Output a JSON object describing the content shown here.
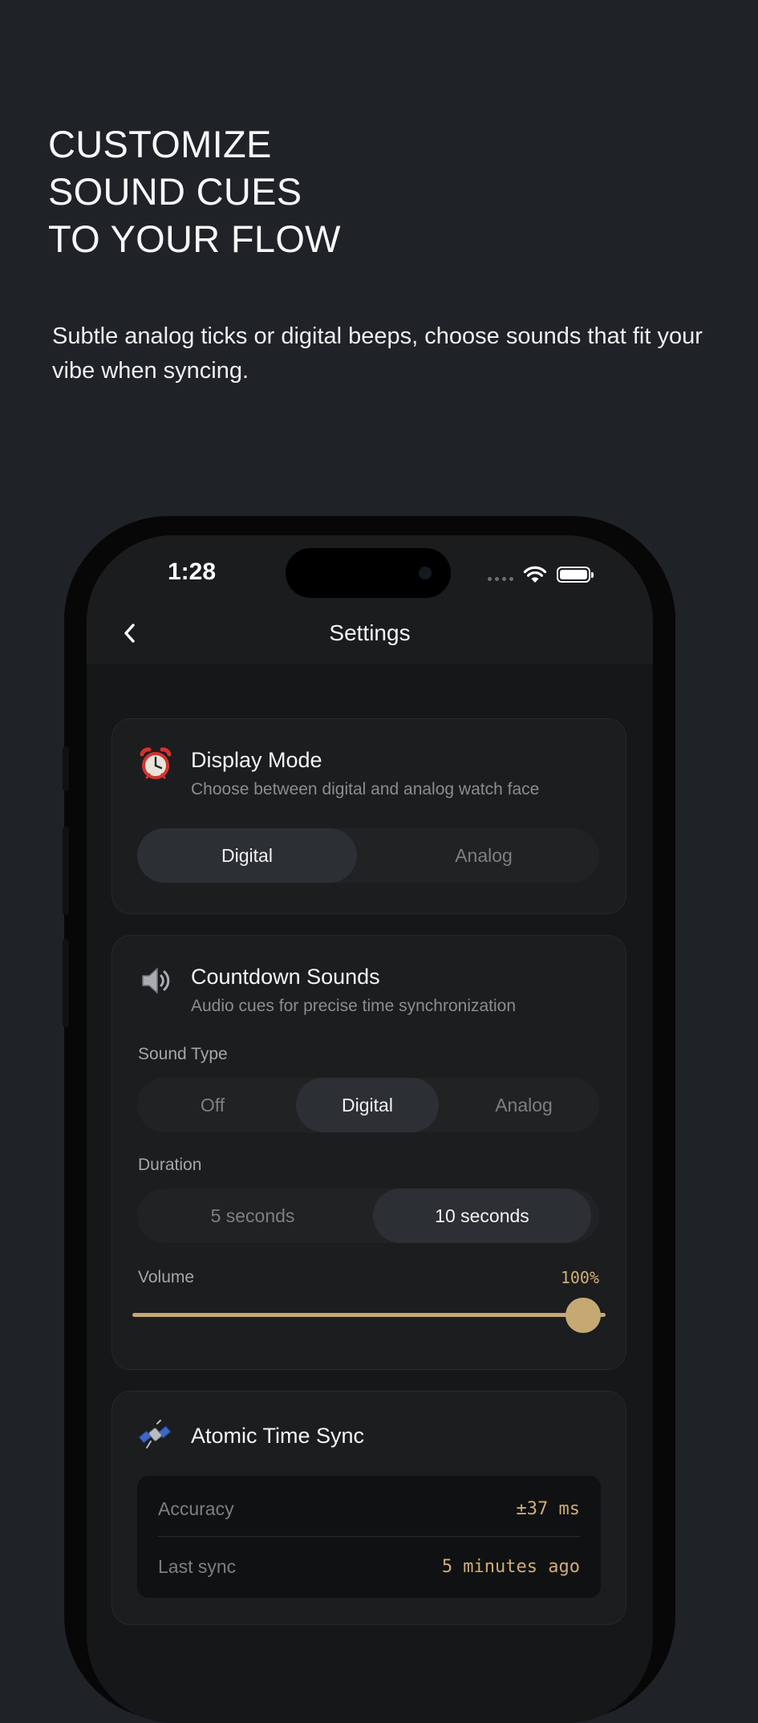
{
  "hero": {
    "title_lines": [
      "CUSTOMIZE",
      "SOUND CUES",
      "TO YOUR FLOW"
    ],
    "subtitle": "Subtle analog ticks or digital beeps, choose sounds that fit your vibe when syncing."
  },
  "status_bar": {
    "time": "1:28",
    "icons": [
      "signal-dots-icon",
      "wifi-icon",
      "battery-icon"
    ]
  },
  "nav": {
    "back_icon": "chevron-left-icon",
    "title": "Settings"
  },
  "display_mode": {
    "icon": "alarm-clock-icon",
    "title": "Display Mode",
    "description": "Choose between digital and analog watch face",
    "options": [
      "Digital",
      "Analog"
    ],
    "selected": "Digital"
  },
  "countdown_sounds": {
    "icon": "speaker-icon",
    "title": "Countdown Sounds",
    "description": "Audio cues for precise time synchronization",
    "sound_type_label": "Sound Type",
    "sound_type_options": [
      "Off",
      "Digital",
      "Analog"
    ],
    "sound_type_selected": "Digital",
    "duration_label": "Duration",
    "duration_options": [
      "5 seconds",
      "10 seconds"
    ],
    "duration_selected": "10 seconds",
    "volume_label": "Volume",
    "volume_value": "100%",
    "volume_level": 1.0
  },
  "atomic_sync": {
    "icon": "satellite-icon",
    "title": "Atomic Time Sync",
    "accuracy_label": "Accuracy",
    "accuracy_value": "±37 ms",
    "last_sync_label": "Last sync",
    "last_sync_value": "5 minutes ago"
  },
  "colors": {
    "background": "#1f2226",
    "accent": "#c6a873",
    "card": "#1b1d1f"
  }
}
